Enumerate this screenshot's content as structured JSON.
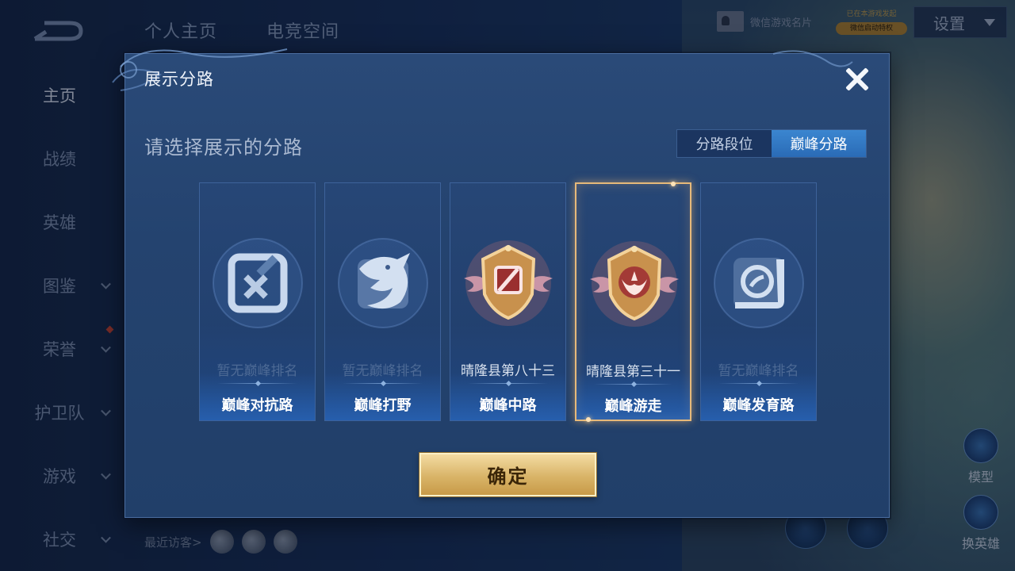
{
  "top_tabs": [
    "个人主页",
    "电竞空间"
  ],
  "sidebar": {
    "items": [
      {
        "label": "主页",
        "active": true
      },
      {
        "label": "战绩"
      },
      {
        "label": "英雄"
      },
      {
        "label": "图鉴",
        "chevron": true
      },
      {
        "label": "荣誉",
        "chevron": true,
        "red_dot": true
      },
      {
        "label": "护卫队",
        "chevron": true
      },
      {
        "label": "游戏",
        "chevron": true
      },
      {
        "label": "社交",
        "chevron": true
      }
    ]
  },
  "header": {
    "wechat_card": "微信游戏名片",
    "privilege_top": "已在本游戏发起",
    "privilege_pill": "微信启动特权",
    "settings": "设置"
  },
  "visitors": {
    "label": "最近访客>"
  },
  "right_buttons": {
    "model": "模型",
    "switch_hero": "换英雄"
  },
  "modal": {
    "title": "展示分路",
    "subtitle": "请选择展示的分路",
    "segments": [
      {
        "label": "分路段位",
        "active": false
      },
      {
        "label": "巅峰分路",
        "active": true
      }
    ],
    "cards": [
      {
        "rank": "暂无巅峰排名",
        "lane": "巅峰对抗路",
        "emblem": "clash-lane-icon",
        "has_rank": false,
        "selected": false
      },
      {
        "rank": "暂无巅峰排名",
        "lane": "巅峰打野",
        "emblem": "jungle-dragon-icon",
        "has_rank": false,
        "selected": false
      },
      {
        "rank": "晴隆县第八十三",
        "lane": "巅峰中路",
        "emblem": "mid-lane-badge-icon",
        "has_rank": true,
        "selected": false
      },
      {
        "rank": "晴隆县第三十一",
        "lane": "巅峰游走",
        "emblem": "roam-badge-icon",
        "has_rank": true,
        "selected": true
      },
      {
        "rank": "暂无巅峰排名",
        "lane": "巅峰发育路",
        "emblem": "farm-lane-icon",
        "has_rank": false,
        "selected": false
      }
    ],
    "confirm": "确定"
  },
  "colors": {
    "accent_blue": "#2f78c4",
    "gold": "#d9b468",
    "selected_border": "#e6b97a"
  }
}
